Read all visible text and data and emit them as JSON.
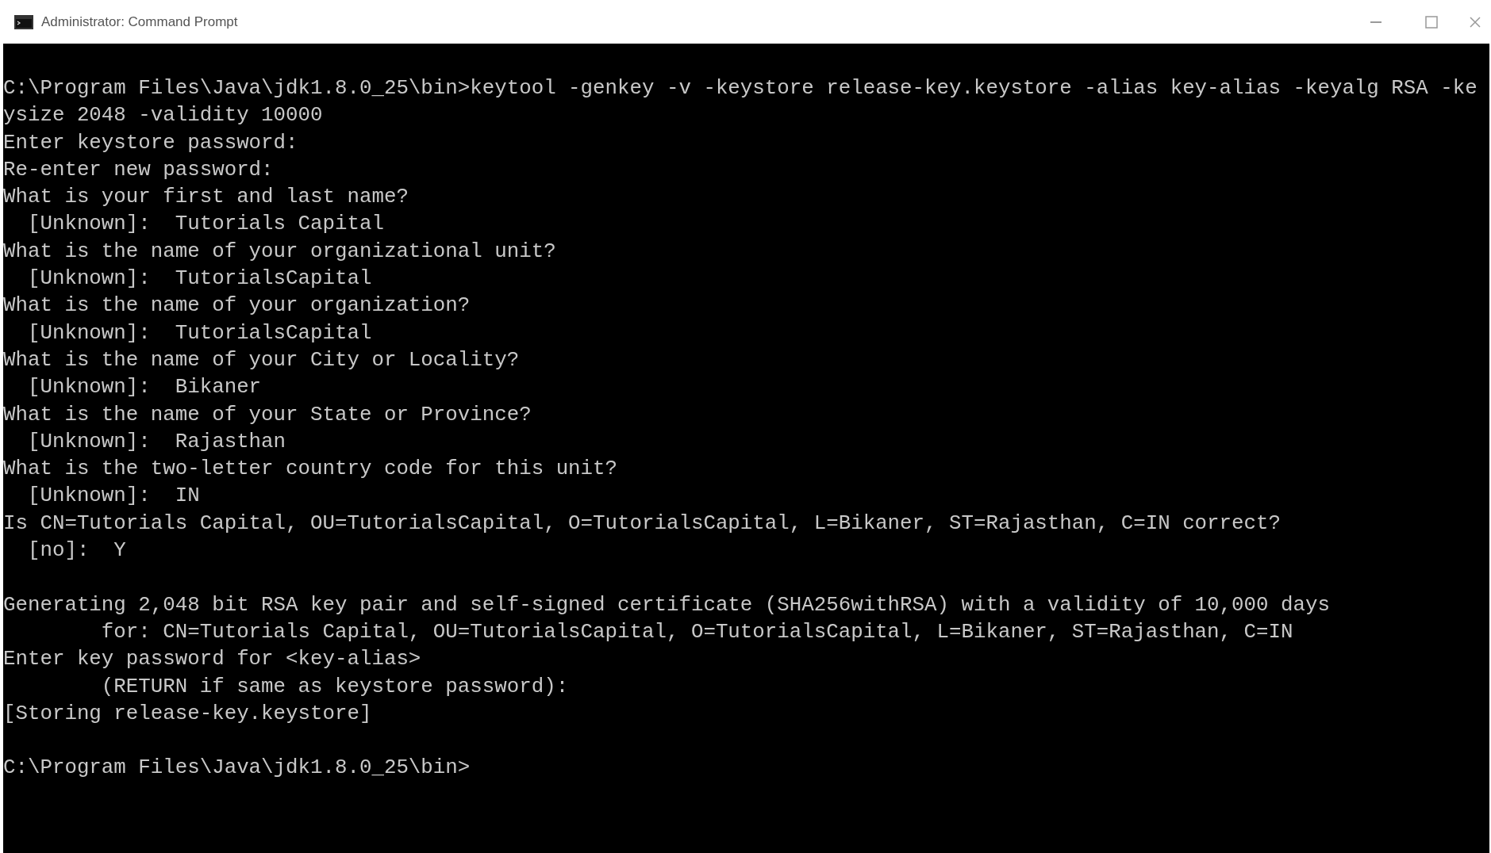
{
  "window": {
    "title": "Administrator: Command Prompt"
  },
  "console": {
    "lines": [
      {
        "kind": "text",
        "text": "C:\\Program Files\\Java\\jdk1.8.0_25\\bin>keytool -genkey -v -keystore release-key.keystore -alias key-alias -keyalg RSA -ke"
      },
      {
        "kind": "text",
        "text": "ysize 2048 -validity 10000"
      },
      {
        "kind": "text",
        "text": "Enter keystore password:"
      },
      {
        "kind": "text",
        "text": "Re-enter new password:"
      },
      {
        "kind": "text",
        "text": "What is your first and last name?"
      },
      {
        "kind": "text",
        "text": "  [Unknown]:  Tutorials Capital"
      },
      {
        "kind": "text",
        "text": "What is the name of your organizational unit?"
      },
      {
        "kind": "text",
        "text": "  [Unknown]:  TutorialsCapital"
      },
      {
        "kind": "text",
        "text": "What is the name of your organization?"
      },
      {
        "kind": "text",
        "text": "  [Unknown]:  TutorialsCapital"
      },
      {
        "kind": "text",
        "text": "What is the name of your City or Locality?"
      },
      {
        "kind": "text",
        "text": "  [Unknown]:  Bikaner"
      },
      {
        "kind": "text",
        "text": "What is the name of your State or Province?"
      },
      {
        "kind": "text",
        "text": "  [Unknown]:  Rajasthan"
      },
      {
        "kind": "text",
        "text": "What is the two-letter country code for this unit?"
      },
      {
        "kind": "text",
        "text": "  [Unknown]:  IN"
      },
      {
        "kind": "text",
        "text": "Is CN=Tutorials Capital, OU=TutorialsCapital, O=TutorialsCapital, L=Bikaner, ST=Rajasthan, C=IN correct?"
      },
      {
        "kind": "text",
        "text": "  [no]:  Y"
      },
      {
        "kind": "blank"
      },
      {
        "kind": "text",
        "text": "Generating 2,048 bit RSA key pair and self-signed certificate (SHA256withRSA) with a validity of 10,000 days"
      },
      {
        "kind": "text",
        "text": "        for: CN=Tutorials Capital, OU=TutorialsCapital, O=TutorialsCapital, L=Bikaner, ST=Rajasthan, C=IN"
      },
      {
        "kind": "text",
        "text": "Enter key password for <key-alias>"
      },
      {
        "kind": "text",
        "text": "        (RETURN if same as keystore password):"
      },
      {
        "kind": "text",
        "text": "[Storing release-key.keystore]"
      },
      {
        "kind": "blank"
      },
      {
        "kind": "text",
        "text": "C:\\Program Files\\Java\\jdk1.8.0_25\\bin>"
      }
    ]
  }
}
